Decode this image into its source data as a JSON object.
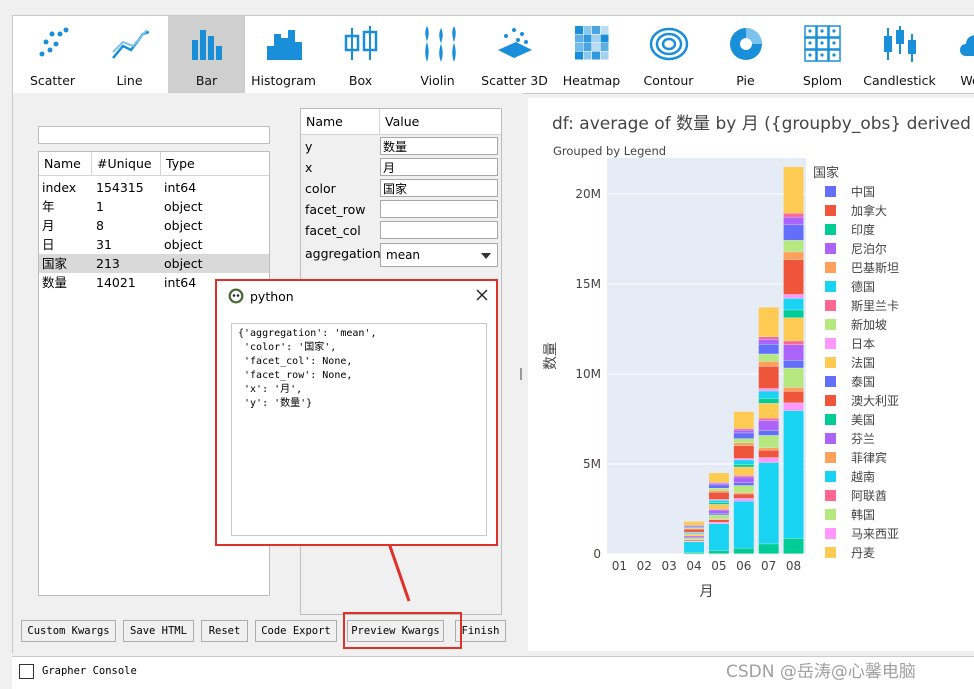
{
  "toolbar": {
    "tools": [
      {
        "label": "Scatter",
        "icon": "scatter-icon"
      },
      {
        "label": "Line",
        "icon": "line-icon"
      },
      {
        "label": "Bar",
        "icon": "bar-icon",
        "active": true
      },
      {
        "label": "Histogram",
        "icon": "histogram-icon"
      },
      {
        "label": "Box",
        "icon": "box-icon"
      },
      {
        "label": "Violin",
        "icon": "violin-icon"
      },
      {
        "label": "Scatter 3D",
        "icon": "scatter-3d-icon"
      },
      {
        "label": "Heatmap",
        "icon": "heatmap-icon"
      },
      {
        "label": "Contour",
        "icon": "contour-icon"
      },
      {
        "label": "Pie",
        "icon": "pie-icon"
      },
      {
        "label": "Splom",
        "icon": "splom-icon"
      },
      {
        "label": "Candlestick",
        "icon": "candlestick-icon"
      },
      {
        "label": "Word",
        "icon": "word-cloud-icon"
      }
    ],
    "accent": "#1a8fd9"
  },
  "columns": {
    "headers": [
      "Name",
      "#Unique",
      "Type"
    ],
    "rows": [
      [
        "index",
        "154315",
        "int64"
      ],
      [
        "年",
        "1",
        "object"
      ],
      [
        "月",
        "8",
        "object"
      ],
      [
        "日",
        "31",
        "object"
      ],
      [
        "国家",
        "213",
        "object"
      ],
      [
        "数量",
        "14021",
        "int64"
      ]
    ],
    "selected_row": 4
  },
  "properties": {
    "headers": [
      "Name",
      "Value"
    ],
    "rows": [
      {
        "name": "y",
        "value": "数量"
      },
      {
        "name": "x",
        "value": "月"
      },
      {
        "name": "color",
        "value": "国家"
      },
      {
        "name": "facet_row",
        "value": ""
      },
      {
        "name": "facet_col",
        "value": ""
      }
    ],
    "aggregation": {
      "name": "aggregation",
      "value": "mean"
    }
  },
  "buttons": [
    "Custom Kwargs",
    "Save HTML",
    "Reset",
    "Code Export",
    "Preview Kwargs",
    "Finish"
  ],
  "dialog": {
    "title": "python",
    "code": "{'aggregation': 'mean',\n 'color': '国家',\n 'facet_col': None,\n 'facet_row': None,\n 'x': '月',\n 'y': '数量'}"
  },
  "console": {
    "label": "Grapher Console"
  },
  "watermark": "CSDN @岳涛@心馨电脑",
  "chart_data": {
    "type": "bar",
    "title": "df: average of 数量  by 月 ({groupby_obs} derived obs.",
    "subtitle": "Grouped by Legend",
    "xlabel": "月",
    "ylabel": "数量",
    "categories": [
      "01",
      "02",
      "03",
      "04",
      "05",
      "06",
      "07",
      "08"
    ],
    "ylim": [
      0,
      22000000
    ],
    "yticks": [
      {
        "v": 0,
        "label": "0"
      },
      {
        "v": 5000000,
        "label": "5M"
      },
      {
        "v": 10000000,
        "label": "10M"
      },
      {
        "v": 15000000,
        "label": "15M"
      },
      {
        "v": 20000000,
        "label": "20M"
      }
    ],
    "totals": [
      0,
      0,
      0,
      1800000,
      4500000,
      7900000,
      13700000,
      21500000
    ],
    "legend_title": "国家",
    "legend": [
      {
        "name": "中国",
        "color": "#636efa"
      },
      {
        "name": "加拿大",
        "color": "#ef553b"
      },
      {
        "name": "印度",
        "color": "#00cc96"
      },
      {
        "name": "尼泊尔",
        "color": "#ab63fa"
      },
      {
        "name": "巴基斯坦",
        "color": "#ffa15a"
      },
      {
        "name": "德国",
        "color": "#19d3f3"
      },
      {
        "name": "斯里兰卡",
        "color": "#ff6692"
      },
      {
        "name": "新加坡",
        "color": "#b6e880"
      },
      {
        "name": "日本",
        "color": "#ff97ff"
      },
      {
        "name": "法国",
        "color": "#fecb52"
      },
      {
        "name": "泰国",
        "color": "#636efa"
      },
      {
        "name": "澳大利亚",
        "color": "#ef553b"
      },
      {
        "name": "美国",
        "color": "#00cc96"
      },
      {
        "name": "芬兰",
        "color": "#ab63fa"
      },
      {
        "name": "菲律宾",
        "color": "#ffa15a"
      },
      {
        "name": "越南",
        "color": "#19d3f3"
      },
      {
        "name": "阿联酋",
        "color": "#ff6692"
      },
      {
        "name": "韩国",
        "color": "#b6e880"
      },
      {
        "name": "马来西亚",
        "color": "#ff97ff"
      },
      {
        "name": "丹麦",
        "color": "#fecb52"
      }
    ],
    "legend_placement": "right",
    "plot_bg": "#e5ecf6",
    "grid": true
  }
}
